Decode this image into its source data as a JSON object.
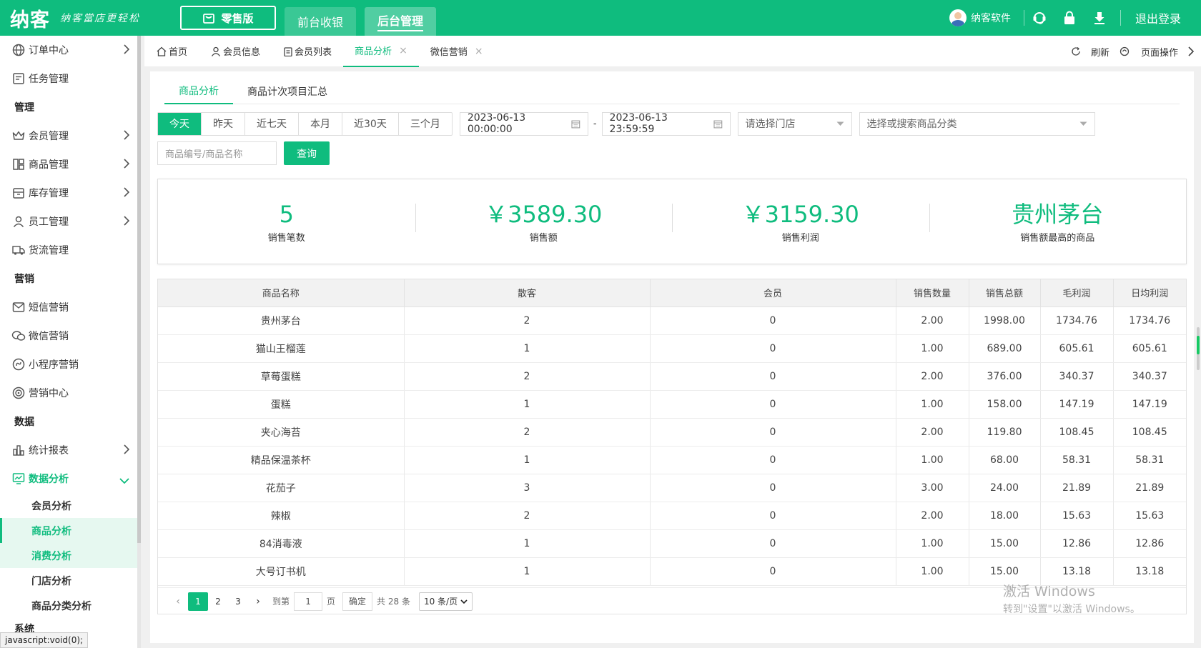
{
  "header": {
    "logo": "纳客",
    "slogan": "纳客當店更轻松",
    "edition": "零售版",
    "tabs": [
      "前台收银",
      "后台管理"
    ],
    "user": "纳客软件",
    "logout": "退出登录"
  },
  "sidebar": {
    "items": [
      {
        "label": "订单中心",
        "icon": "globe-icon"
      },
      {
        "label": "任务管理",
        "icon": "task-icon"
      }
    ],
    "group_manage": "管理",
    "manage_items": [
      {
        "label": "会员管理",
        "icon": "crown-icon"
      },
      {
        "label": "商品管理",
        "icon": "goods-icon"
      },
      {
        "label": "库存管理",
        "icon": "inventory-icon"
      },
      {
        "label": "员工管理",
        "icon": "person-icon"
      },
      {
        "label": "货流管理",
        "icon": "truck-icon"
      }
    ],
    "group_marketing": "营销",
    "marketing_items": [
      {
        "label": "短信营销",
        "icon": "mail-icon"
      },
      {
        "label": "微信营销",
        "icon": "wechat-icon"
      },
      {
        "label": "小程序营销",
        "icon": "miniapp-icon"
      },
      {
        "label": "营销中心",
        "icon": "target-icon"
      }
    ],
    "group_data": "数据",
    "data_items": [
      {
        "label": "统计报表",
        "icon": "barchart-icon"
      },
      {
        "label": "数据分析",
        "icon": "monitor-chart-icon"
      }
    ],
    "sub_items": [
      "会员分析",
      "商品分析",
      "消费分析",
      "门店分析",
      "商品分类分析"
    ],
    "group_system": "系统",
    "status_text": "javascript:void(0);"
  },
  "tabsbar": {
    "tabs": [
      "首页",
      "会员信息",
      "会员列表",
      "商品分析",
      "微信营销"
    ],
    "refresh": "刷新",
    "page_ops": "页面操作"
  },
  "subtabs": [
    "商品分析",
    "商品计次项目汇总"
  ],
  "filters": {
    "ranges": [
      "今天",
      "昨天",
      "近七天",
      "本月",
      "近30天",
      "三个月"
    ],
    "start": "2023-06-13 00:00:00",
    "end": "2023-06-13 23:59:59",
    "dash": "-",
    "store_placeholder": "请选择门店",
    "category_placeholder": "选择或搜索商品分类",
    "search_placeholder": "商品编号/商品名称",
    "query": "查询"
  },
  "stats": [
    {
      "value": "5",
      "label": "销售笔数"
    },
    {
      "value": "￥3589.30",
      "label": "销售额"
    },
    {
      "value": "￥3159.30",
      "label": "销售利润"
    },
    {
      "value": "贵州茅台",
      "label": "销售额最高的商品"
    }
  ],
  "table": {
    "headers": [
      "商品名称",
      "散客",
      "会员",
      "销售数量",
      "销售总额",
      "毛利润",
      "日均利润"
    ],
    "rows": [
      [
        "贵州茅台",
        "2",
        "0",
        "2.00",
        "1998.00",
        "1734.76",
        "1734.76"
      ],
      [
        "猫山王榴莲",
        "1",
        "0",
        "1.00",
        "689.00",
        "605.61",
        "605.61"
      ],
      [
        "草莓蛋糕",
        "2",
        "0",
        "2.00",
        "376.00",
        "340.37",
        "340.37"
      ],
      [
        "蛋糕",
        "1",
        "0",
        "1.00",
        "158.00",
        "147.19",
        "147.19"
      ],
      [
        "夹心海苔",
        "2",
        "0",
        "2.00",
        "119.80",
        "108.45",
        "108.45"
      ],
      [
        "精品保温茶杯",
        "1",
        "0",
        "1.00",
        "68.00",
        "58.31",
        "58.31"
      ],
      [
        "花茄子",
        "3",
        "0",
        "3.00",
        "24.00",
        "21.89",
        "21.89"
      ],
      [
        "辣椒",
        "2",
        "0",
        "2.00",
        "18.00",
        "15.63",
        "15.63"
      ],
      [
        "84消毒液",
        "1",
        "0",
        "1.00",
        "15.00",
        "12.86",
        "12.86"
      ],
      [
        "大号订书机",
        "1",
        "0",
        "1.00",
        "15.00",
        "13.18",
        "13.18"
      ]
    ]
  },
  "pager": {
    "pages": [
      "1",
      "2",
      "3"
    ],
    "goto_label": "到第",
    "goto_value": "1",
    "page_unit": "页",
    "confirm": "确定",
    "total": "共 28 条",
    "page_size": "10 条/页"
  },
  "watermark": {
    "line1": "激活 Windows",
    "line2": "转到\"设置\"以激活 Windows。"
  },
  "colors": {
    "primary": "#0fbc7e"
  }
}
